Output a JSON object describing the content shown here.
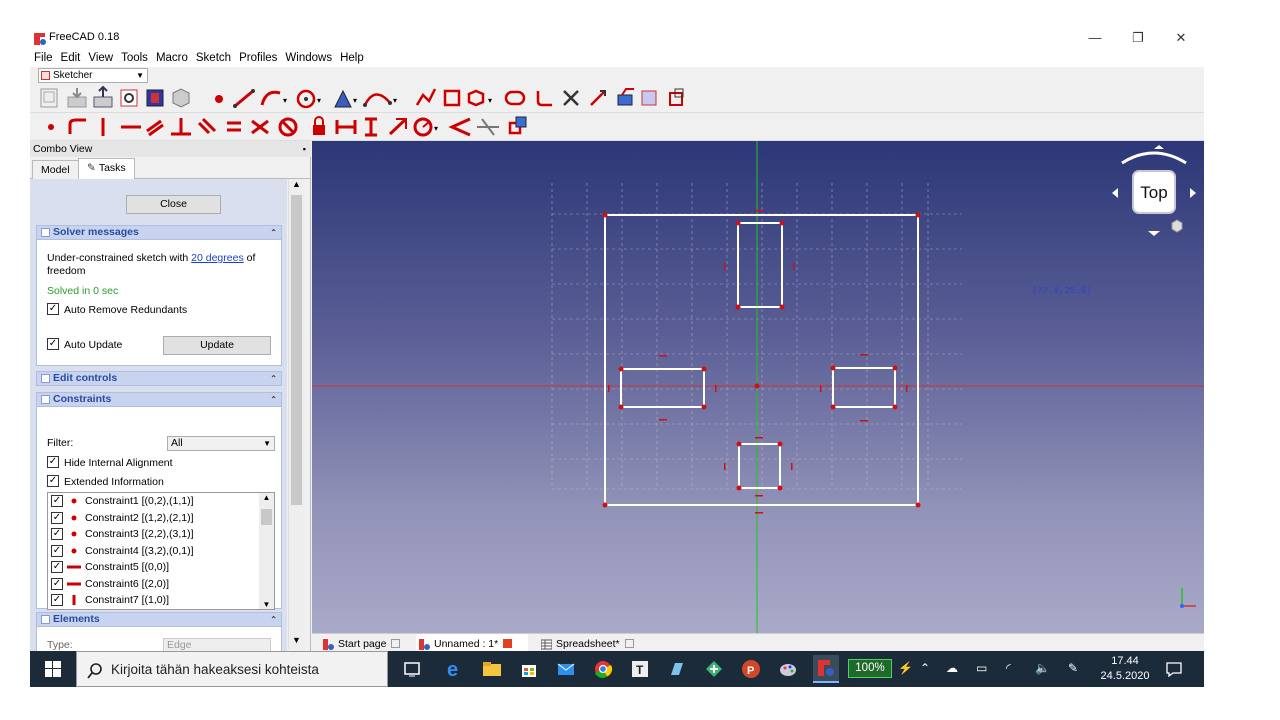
{
  "window": {
    "title": "FreeCAD 0.18",
    "minimize": "—",
    "restore": "❐",
    "close": "✕"
  },
  "menu": [
    "File",
    "Edit",
    "View",
    "Tools",
    "Macro",
    "Sketch",
    "Profiles",
    "Windows",
    "Help"
  ],
  "workbench": {
    "selected": "Sketcher"
  },
  "combo": {
    "title": "Combo View",
    "tabs": {
      "model": "Model",
      "tasks": "Tasks"
    }
  },
  "tasks": {
    "close_label": "Close",
    "solver": {
      "title": "Solver messages",
      "message_prefix": "Under-constrained sketch with",
      "message_link": "20 degrees",
      "message_suffix": "of freedom",
      "status": "Solved in 0 sec",
      "status_color": "#2a9d2a",
      "auto_remove": "Auto Remove Redundants",
      "auto_update": "Auto Update",
      "update_label": "Update"
    },
    "edit_controls": {
      "title": "Edit controls"
    },
    "constraints": {
      "title": "Constraints",
      "filter_label": "Filter:",
      "filter_value": "All",
      "hide_internal": "Hide Internal Alignment",
      "extended_info": "Extended Information",
      "items": [
        {
          "label": "Constraint1 [(0,2),(1,1)]",
          "kind": "coincident"
        },
        {
          "label": "Constraint2 [(1,2),(2,1)]",
          "kind": "coincident"
        },
        {
          "label": "Constraint3 [(2,2),(3,1)]",
          "kind": "coincident"
        },
        {
          "label": "Constraint4 [(3,2),(0,1)]",
          "kind": "coincident"
        },
        {
          "label": "Constraint5 [(0,0)]",
          "kind": "horizontal"
        },
        {
          "label": "Constraint6 [(2,0)]",
          "kind": "horizontal"
        },
        {
          "label": "Constraint7 [(1,0)]",
          "kind": "vertical"
        }
      ]
    },
    "elements": {
      "title": "Elements",
      "type_label": "Type:",
      "type_value": "Edge"
    }
  },
  "viewport": {
    "coords": "(77.9,25.9)",
    "navcube_face": "Top"
  },
  "doc_tabs": [
    "Start page",
    "Unnamed : 1*",
    "Spreadsheet*"
  ],
  "taskbar": {
    "search_placeholder": "Kirjoita tähän hakeaksesi kohteista",
    "battery": "100%",
    "time": "17.44",
    "date": "24.5.2020"
  },
  "colors": {
    "accent_red": "#c00000",
    "sketch_white": "#ffffff",
    "axis_green": "#22c322",
    "axis_red": "#d23232"
  }
}
